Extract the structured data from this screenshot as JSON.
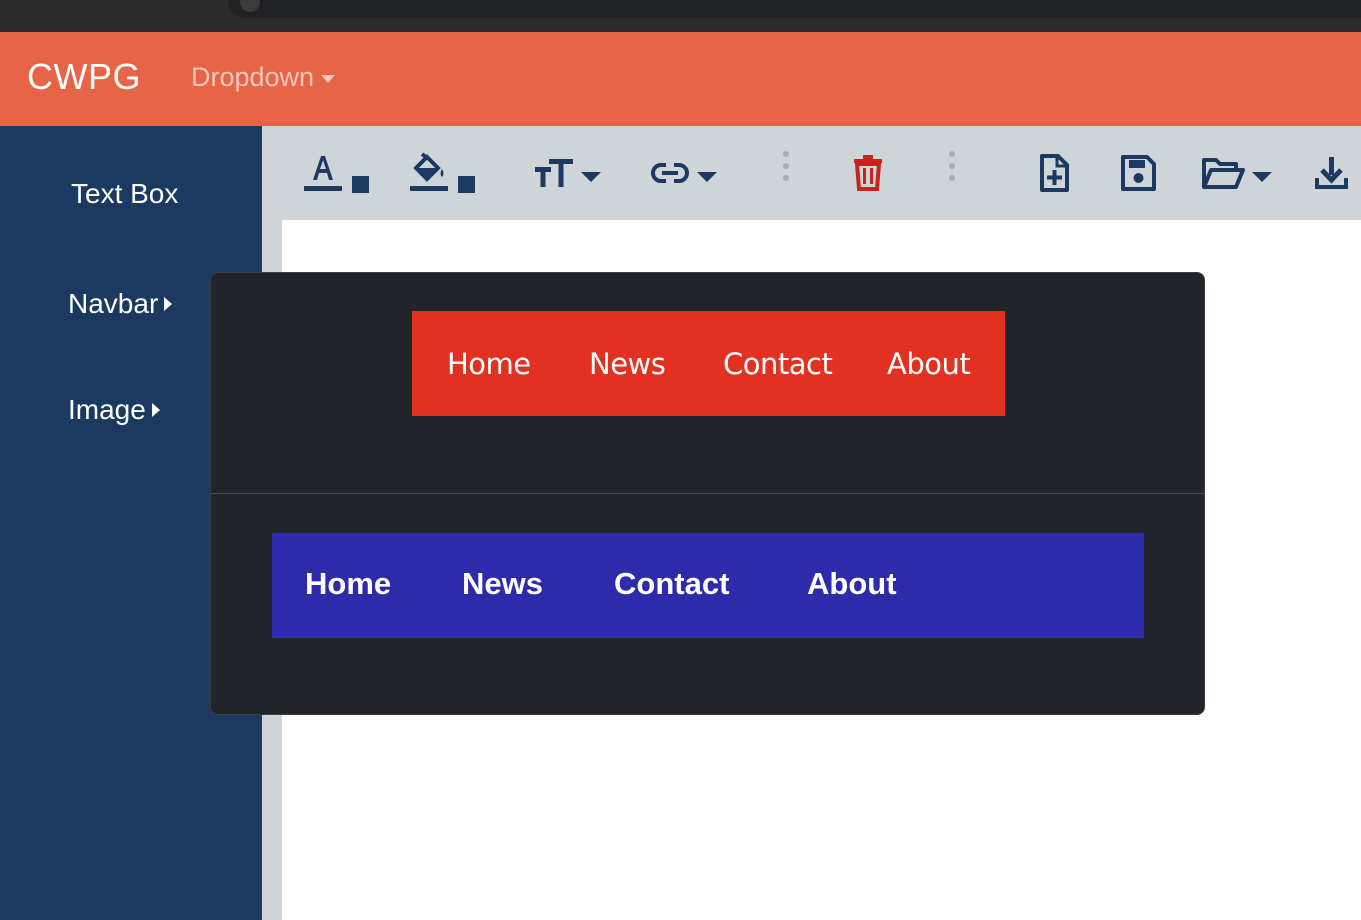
{
  "app": {
    "brand": "CWPG",
    "dropdown_label": "Dropdown"
  },
  "sidebar": {
    "items": [
      {
        "label": "Text Box",
        "has_submenu": false
      },
      {
        "label": "Navbar",
        "has_submenu": true
      },
      {
        "label": "Image",
        "has_submenu": true
      }
    ]
  },
  "toolbar": {
    "tools": [
      {
        "icon": "text-color-icon"
      },
      {
        "icon": "fill-color-icon"
      },
      {
        "icon": "font-size-icon"
      },
      {
        "icon": "link-icon"
      },
      {
        "icon": "delete-icon"
      },
      {
        "icon": "new-file-icon"
      },
      {
        "icon": "save-icon"
      },
      {
        "icon": "open-folder-icon"
      },
      {
        "icon": "download-icon"
      }
    ]
  },
  "navbar_options": [
    {
      "style": "red",
      "links": [
        "Home",
        "News",
        "Contact",
        "About"
      ]
    },
    {
      "style": "blue",
      "links": [
        "Home",
        "News",
        "Contact",
        "About"
      ]
    }
  ],
  "colors": {
    "topnav": "#e66547",
    "sidebar": "#1c3961",
    "toolbar": "#cfd4d9",
    "popup": "#212428",
    "navbar_red": "#e33121",
    "navbar_blue": "#2e2bab",
    "delete_icon": "#c9211b",
    "toolbar_icon": "#1c3961"
  }
}
